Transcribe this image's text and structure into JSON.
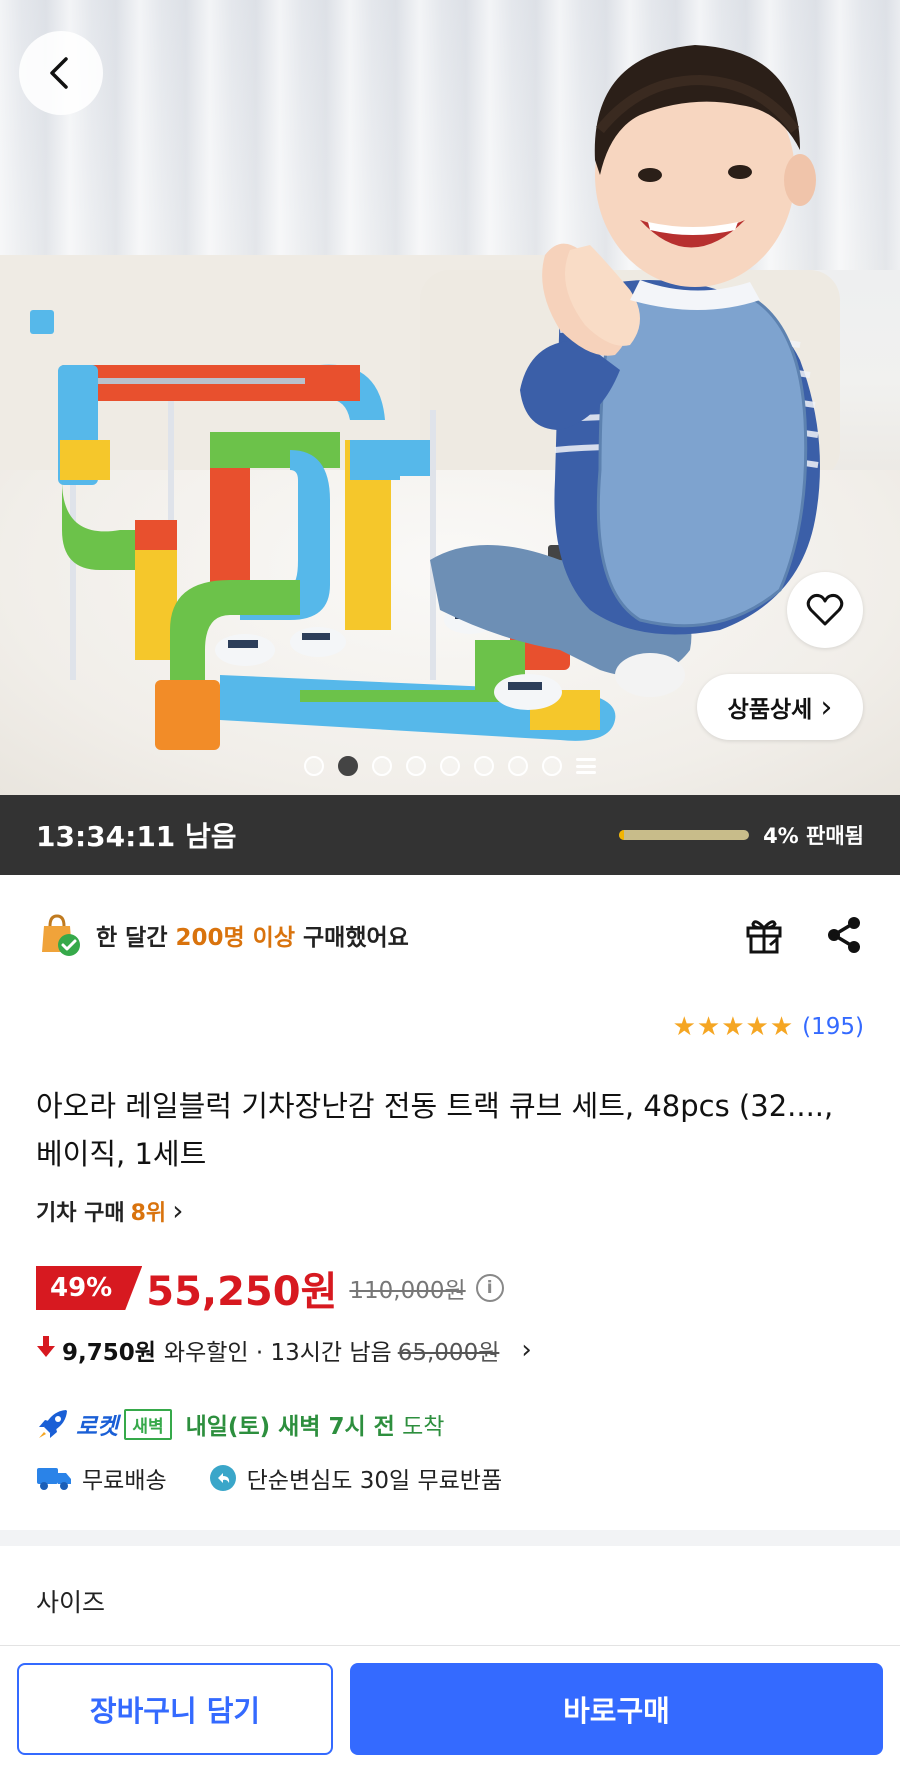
{
  "hero": {
    "image_alt": "product photo",
    "active_slide": 2,
    "slide_count": 8
  },
  "header": {
    "back_icon": "chevron-left-icon"
  },
  "actions": {
    "favorite_icon": "heart-icon",
    "detail_label": "상품상세",
    "detail_chevron": "›"
  },
  "deal": {
    "time_left": "13:34:11 남음",
    "sold_percent": 4,
    "sold_label": "4% 판매됨"
  },
  "purchase": {
    "prefix": "한 달간 ",
    "highlight": "200명 이상",
    "suffix": " 구매했어요",
    "gift_icon": "gift-icon",
    "share_icon": "share-icon"
  },
  "rating": {
    "stars": 5,
    "stars_text": "★★★★★",
    "count": "(195)"
  },
  "product": {
    "title": "아오라 레일블럭 기차장난감 전동 트랙 큐브 세트, 48pcs (32...., 베이직, 1세트",
    "rank_prefix": "기차 구매 ",
    "rank_value": "8위",
    "rank_chevron": "›"
  },
  "price": {
    "discount": "49%",
    "sale": "55,250원",
    "original": "110,000원",
    "info_icon": "i"
  },
  "wow": {
    "arrow": "🡇",
    "amount": "9,750원",
    "label": "와우할인 · 13시간 남음",
    "original": "65,000원",
    "chevron": "›"
  },
  "delivery": {
    "rocket_label": "로켓",
    "dawn_badge": "새벽",
    "arrival_bold": "내일(토) 새벽 7시 전",
    "arrival_normal": " 도착",
    "free_shipping": "무료배송",
    "free_return": "단순변심도 30일 무료반품"
  },
  "options": {
    "size_label": "사이즈"
  },
  "footer": {
    "cart_label": "장바구니 담기",
    "buy_label": "바로구매"
  },
  "colors": {
    "accent_blue": "#346aff",
    "sale_red": "#d71920",
    "rocket_green": "#2d8f3e",
    "highlight_orange": "#d9730d"
  }
}
